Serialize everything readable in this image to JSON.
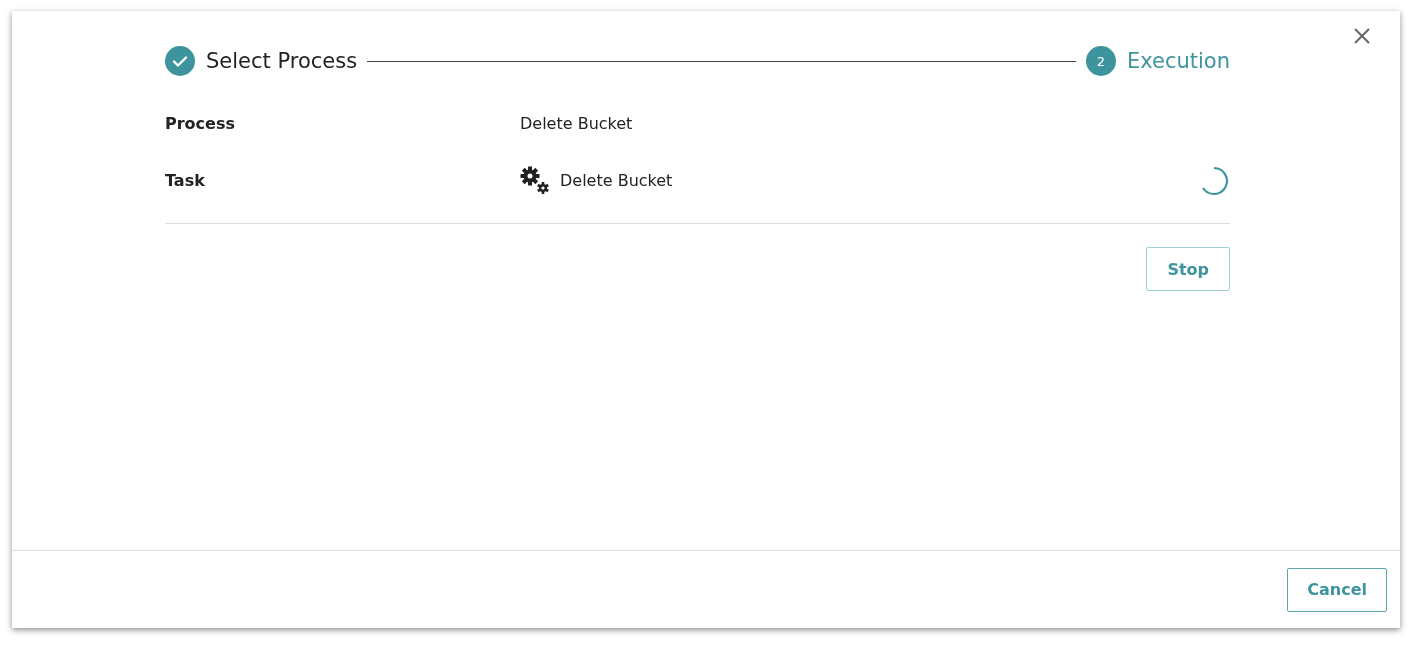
{
  "steps": [
    {
      "label": "Select Process",
      "done": true,
      "current": false
    },
    {
      "label": "Execution",
      "number": "2",
      "done": false,
      "current": true
    }
  ],
  "details": [
    {
      "label": "Process",
      "value": "Delete Bucket",
      "kind": "text",
      "running": false
    },
    {
      "label": "Task",
      "value": "Delete Bucket",
      "kind": "task",
      "running": true
    }
  ],
  "actions": [
    "Stop"
  ],
  "footer_buttons": [
    "Cancel"
  ]
}
